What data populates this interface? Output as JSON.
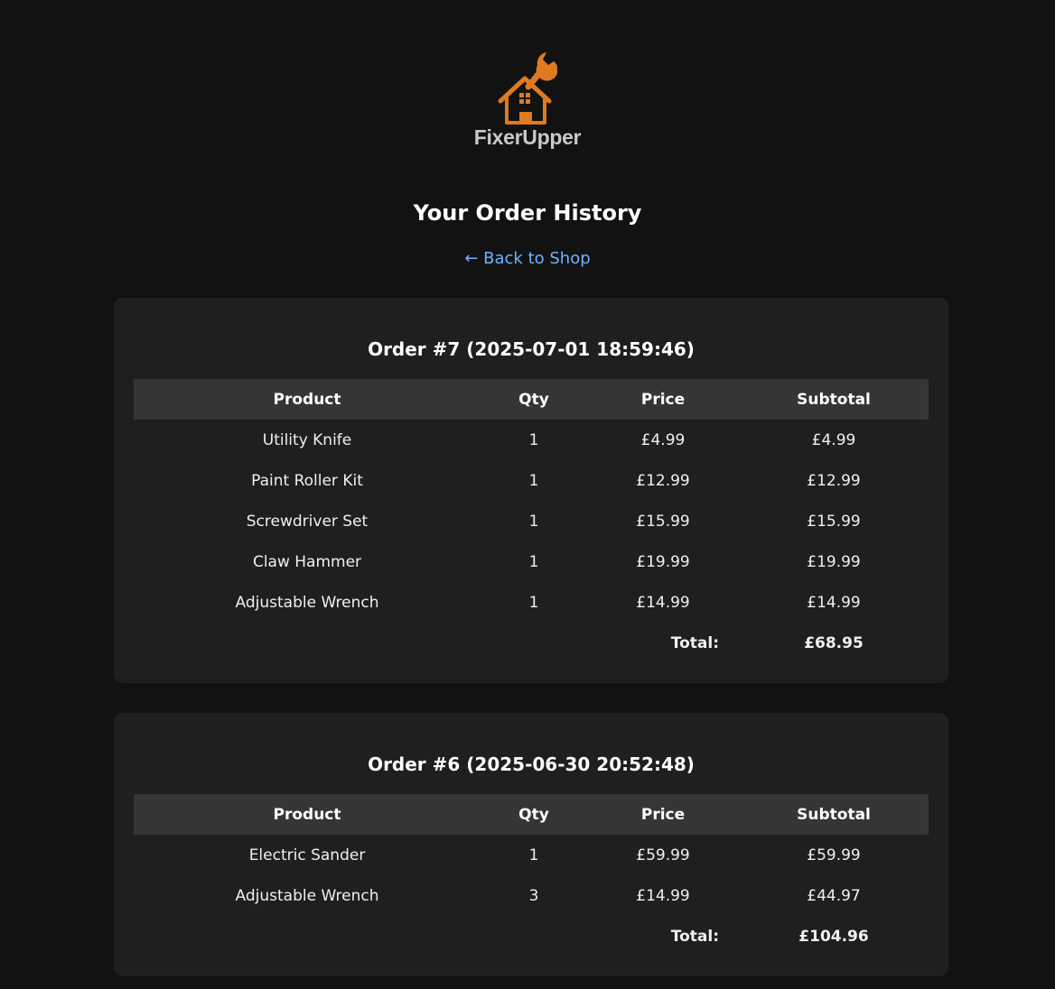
{
  "brand": {
    "name": "FixerUpper",
    "accent": "#e07a1f"
  },
  "page": {
    "title": "Your Order History",
    "back_link": "← Back to Shop"
  },
  "orders": [
    {
      "heading": "Order #7 (2025-07-01 18:59:46)",
      "columns": [
        "Product",
        "Qty",
        "Price",
        "Subtotal"
      ],
      "items": [
        {
          "product": "Utility Knife",
          "qty": "1",
          "price": "£4.99",
          "subtotal": "£4.99"
        },
        {
          "product": "Paint Roller Kit",
          "qty": "1",
          "price": "£12.99",
          "subtotal": "£12.99"
        },
        {
          "product": "Screwdriver Set",
          "qty": "1",
          "price": "£15.99",
          "subtotal": "£15.99"
        },
        {
          "product": "Claw Hammer",
          "qty": "1",
          "price": "£19.99",
          "subtotal": "£19.99"
        },
        {
          "product": "Adjustable Wrench",
          "qty": "1",
          "price": "£14.99",
          "subtotal": "£14.99"
        }
      ],
      "total_label": "Total:",
      "total": "£68.95"
    },
    {
      "heading": "Order #6 (2025-06-30 20:52:48)",
      "columns": [
        "Product",
        "Qty",
        "Price",
        "Subtotal"
      ],
      "items": [
        {
          "product": "Electric Sander",
          "qty": "1",
          "price": "£59.99",
          "subtotal": "£59.99"
        },
        {
          "product": "Adjustable Wrench",
          "qty": "3",
          "price": "£14.99",
          "subtotal": "£44.97"
        }
      ],
      "total_label": "Total:",
      "total": "£104.96"
    }
  ]
}
